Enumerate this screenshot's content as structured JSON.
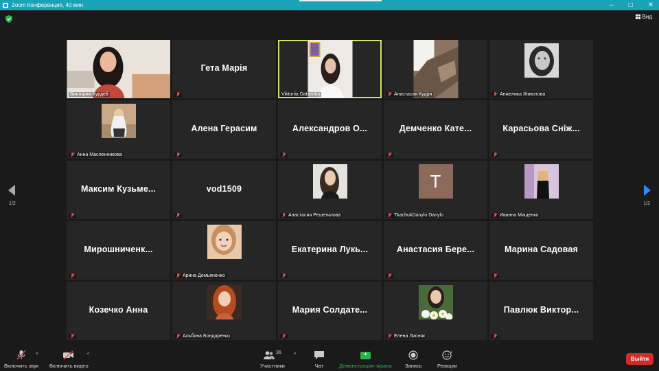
{
  "window": {
    "title": "Zoom Конференция, 40 мин",
    "controls": [
      "–",
      "□",
      "✕"
    ]
  },
  "view": {
    "label": "Вид"
  },
  "pager": {
    "left": "1/2",
    "right": "1/2"
  },
  "participants": [
    {
      "name": "Виктория  Хурдей",
      "kind": "video",
      "muted": false
    },
    {
      "name": "Гета Марія",
      "kind": "name",
      "muted": true
    },
    {
      "name": "Viktoriia Datsenko",
      "kind": "video",
      "muted": false,
      "active": true
    },
    {
      "name": "Анастасия Кудря",
      "kind": "video",
      "muted": true
    },
    {
      "name": "Анжелика Животова",
      "kind": "photo",
      "muted": true
    },
    {
      "name": "Анна Масленникова",
      "kind": "photo",
      "muted": true
    },
    {
      "name": "Алена Герасим",
      "kind": "name",
      "muted": true
    },
    {
      "name": "Александров  О...",
      "kind": "name",
      "muted": true
    },
    {
      "name": "Демченко  Кате...",
      "kind": "name",
      "muted": true
    },
    {
      "name": "Карасьова  Сніж...",
      "kind": "name",
      "muted": true
    },
    {
      "name": "Максим  Кузьме...",
      "kind": "name",
      "muted": true
    },
    {
      "name": "vod1509",
      "kind": "name",
      "muted": true
    },
    {
      "name": "Анастасия Решетилова",
      "kind": "photo",
      "muted": true
    },
    {
      "name": "TkachukDanylo Danylo",
      "kind": "letter",
      "letter": "T",
      "muted": true
    },
    {
      "name": "Иванна Мищенко",
      "kind": "photo",
      "muted": true
    },
    {
      "name": "Мирошниченк...",
      "kind": "name",
      "muted": true
    },
    {
      "name": "Арина Демьяненко",
      "kind": "photo",
      "muted": true
    },
    {
      "name": "Екатерина  Лукь...",
      "kind": "name",
      "muted": true
    },
    {
      "name": "Анастасия  Бере...",
      "kind": "name",
      "muted": true
    },
    {
      "name": "Марина Садовая",
      "kind": "name",
      "muted": true
    },
    {
      "name": "Козечко Анна",
      "kind": "name",
      "muted": true
    },
    {
      "name": "Альбина Бондаренко",
      "kind": "photo",
      "muted": true
    },
    {
      "name": "Мария  Солдате...",
      "kind": "name",
      "muted": true
    },
    {
      "name": "Елена Лисняк",
      "kind": "photo",
      "muted": true
    },
    {
      "name": "Павлюк  Виктор...",
      "kind": "name",
      "muted": true
    }
  ],
  "toolbar": {
    "audio": "Включить звук",
    "video": "Включить видео",
    "participants": "Участники",
    "participants_count": "36",
    "chat": "Чат",
    "share": "Демонстрация экрана",
    "record": "Запись",
    "reactions": "Реакции",
    "leave": "Выйти"
  },
  "colors": {
    "titlebar": "#18a3b7",
    "active_border": "#d5e35c",
    "share_green": "#2ab34a",
    "leave_red": "#d12b2b",
    "muted_red": "#e04a4a"
  }
}
